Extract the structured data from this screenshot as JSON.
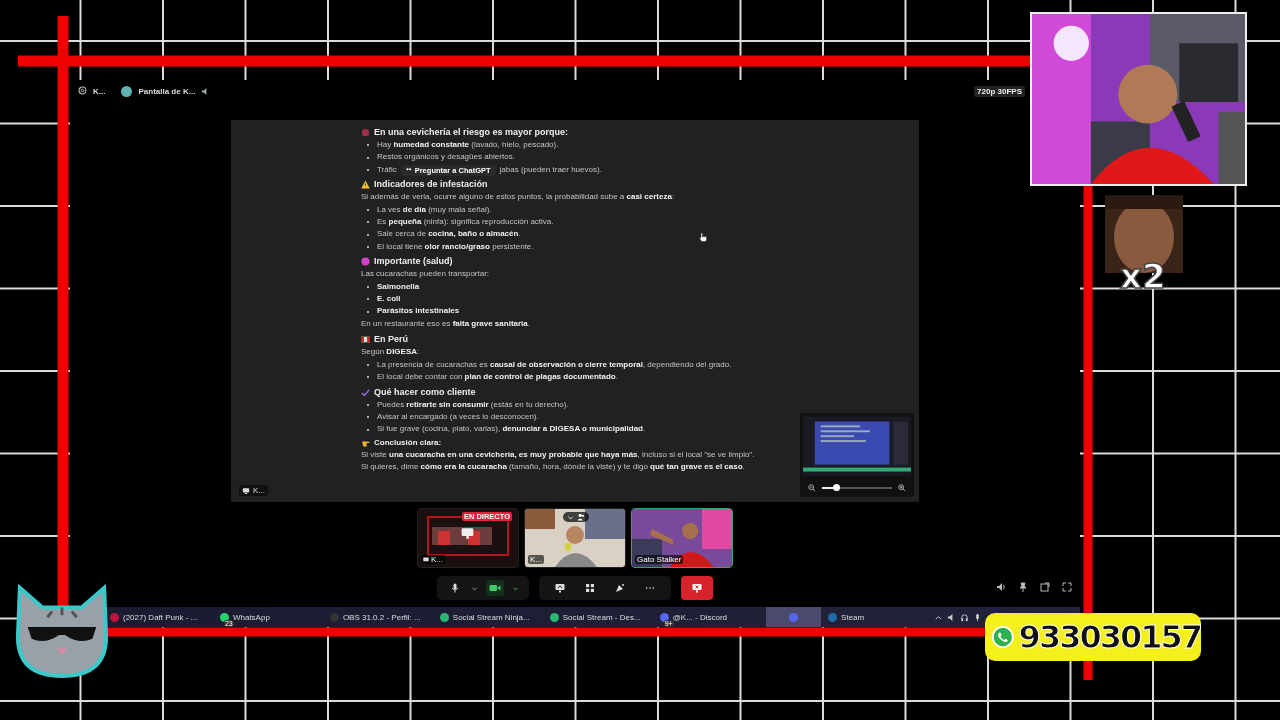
{
  "call_header": {
    "user": "K...",
    "stream_title": "Pantalla de K..."
  },
  "quality_badge": "720p 30FPS",
  "document": [
    {
      "kind": "alert_heading",
      "text": "En una cevichería el riesgo es mayor porque:"
    },
    {
      "kind": "bullet",
      "text": "Hay **humedad constante** (lavado, hielo, pescado)."
    },
    {
      "kind": "bullet",
      "text": "Restos orgánicos y desagües abiertos."
    },
    {
      "kind": "popup_bullet",
      "text": "Tráfic",
      "popup": "Preguntar a ChatGPT",
      "text_after": "jabas (pueden traer huevos)."
    },
    {
      "kind": "warning_heading",
      "text": "Indicadores de infestación"
    },
    {
      "kind": "paragraph",
      "text": "Si además de verla, ocurre alguno de estos puntos, la probabilidad sube a **casi certeza**:"
    },
    {
      "kind": "bullet",
      "text": "La ves **de día** (muy mala señal)."
    },
    {
      "kind": "bullet",
      "text": "Es **pequeña** (ninfa): significa reproducción activa."
    },
    {
      "kind": "bullet",
      "text": "Sale cerca de **cocina, baño o almacén**."
    },
    {
      "kind": "bullet",
      "text": "El local tiene **olor rancio/graso** persistente."
    },
    {
      "kind": "health_heading",
      "text": "Importante (salud)"
    },
    {
      "kind": "paragraph",
      "text": "Las cucarachas pueden transportar:"
    },
    {
      "kind": "bold_bullet",
      "text": "Salmonella"
    },
    {
      "kind": "bold_bullet",
      "text": "E. coli"
    },
    {
      "kind": "bold_bullet",
      "text": "Parásitos intestinales"
    },
    {
      "kind": "paragraph",
      "text": "En un restaurante eso es **falta grave sanitaria**."
    },
    {
      "kind": "country_heading",
      "text": "En Perú"
    },
    {
      "kind": "paragraph",
      "text": "Según **DIGESA**:"
    },
    {
      "kind": "bullet",
      "text": "La presencia de cucarachas es **causal de observación o cierre temporal**, dependiendo del grado."
    },
    {
      "kind": "bullet",
      "text": "El local debe contar con **plan de control de plagas documentado**."
    },
    {
      "kind": "check_heading",
      "text": "Qué hacer como cliente"
    },
    {
      "kind": "bullet",
      "text": "Puedes **retirarte sin consumir** (estás en tu derecho)."
    },
    {
      "kind": "bullet",
      "text": "Avisar al encargado (a veces lo desconocen)."
    },
    {
      "kind": "bullet",
      "text": "Si fue grave (cocina, plato, varias), **denunciar a DIGESA o municipalidad**."
    },
    {
      "kind": "conclusion_heading",
      "text": "Conclusión clara:"
    },
    {
      "kind": "paragraph",
      "text": "Si viste **una cucaracha en una cevichería, es muy probable que haya más**, incluso si el local \"se ve limpio\"."
    },
    {
      "kind": "paragraph",
      "text": "Si quieres, dime **cómo era la cucaracha** (tamaño, hora, dónde la viste) y te digo **qué tan grave es el caso**."
    }
  ],
  "stream_label": "K...",
  "preview": {
    "level": 0.2
  },
  "participants": [
    {
      "name": "K...",
      "live_badge": "EN DIRECTO",
      "speaking": false
    },
    {
      "name": "K...",
      "speaking": false
    },
    {
      "name": "Gato Stalker",
      "speaking": true
    }
  ],
  "controls": {
    "mic": {
      "on": true
    },
    "camera": {
      "on": true
    }
  },
  "taskbar": [
    {
      "label": "(2027) Daft Punk - ...",
      "selected": false
    },
    {
      "label": "WhatsApp",
      "badge": "23",
      "selected": false
    },
    {
      "label": "OBS 31.0.2 - Perfil: ...",
      "selected": false
    },
    {
      "label": "Social Stream Ninja...",
      "selected": false
    },
    {
      "label": "Social Stream - Des...",
      "selected": false
    },
    {
      "label": "@K... - Discord",
      "badge": "9+",
      "selected": false
    },
    {
      "selected": true
    },
    {
      "label": "Steam",
      "selected": false
    }
  ],
  "multiplier": "x2",
  "phone": "933030157"
}
